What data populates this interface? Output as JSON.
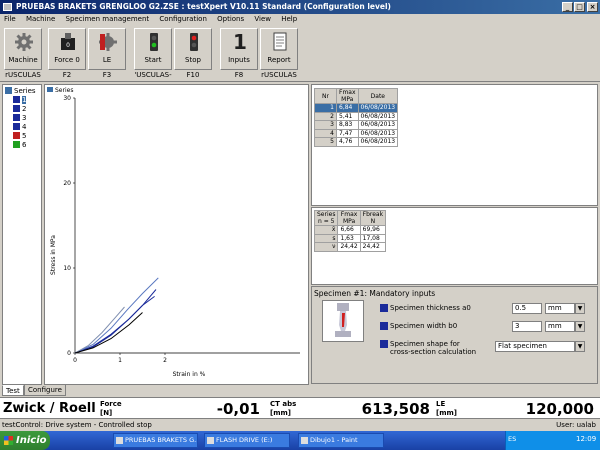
{
  "window": {
    "title": "PRUEBAS BRAKETS GRENGLOO G2.ZSE : testXpert V10.11 Standard (Configuration level)",
    "controls": [
      "_",
      "□",
      "×"
    ]
  },
  "menu": [
    "File",
    "Machine",
    "Specimen management",
    "Configuration",
    "Options",
    "View",
    "Help"
  ],
  "toolbar": [
    {
      "label": "Machine",
      "key": "rUSCULAS",
      "icon": "gear-icon"
    },
    {
      "label": "Force 0",
      "key": "F2",
      "icon": "force-zero-icon"
    },
    {
      "label": "LE",
      "key": "F3",
      "icon": "le-gear-icon"
    },
    {
      "label": "Start",
      "key": "'USCULAS-",
      "icon": "traffic-light-green-icon"
    },
    {
      "label": "Stop",
      "key": "F10",
      "icon": "traffic-light-red-icon"
    },
    {
      "label": "Inputs",
      "key": "F8",
      "icon": "inputs-number-icon",
      "glyph": "1"
    },
    {
      "label": "Report",
      "key": "rUSCULAS",
      "icon": "report-icon"
    }
  ],
  "tree": {
    "root": "Series",
    "items": [
      "1",
      "2",
      "3",
      "4",
      "5",
      "6"
    ]
  },
  "chart_data": {
    "type": "line",
    "legend": "Series",
    "xlabel": "Strain in %",
    "ylabel": "Stress in MPa",
    "xlim": [
      0,
      5
    ],
    "ylim": [
      0,
      30
    ],
    "xticks": [
      "0",
      "1",
      "2"
    ],
    "yticks": [
      "0",
      "10",
      "20",
      "30"
    ],
    "series": [
      {
        "color": "#1a2a9a",
        "x": [
          0,
          0.4,
          0.8,
          1.2,
          1.5,
          1.77
        ],
        "y": [
          0,
          0.8,
          2.2,
          4.0,
          5.6,
          6.66
        ]
      },
      {
        "color": "#5a78c0",
        "x": [
          0,
          0.4,
          0.8,
          1.2,
          1.5,
          1.85
        ],
        "y": [
          0,
          1.0,
          2.9,
          5.3,
          7.0,
          8.83
        ]
      },
      {
        "color": "#1a2a9a",
        "x": [
          0,
          0.4,
          0.8,
          1.2,
          1.5,
          1.8
        ],
        "y": [
          0,
          0.7,
          2.1,
          4.0,
          5.6,
          7.47
        ]
      },
      {
        "color": "#7f8fb0",
        "x": [
          0,
          0.3,
          0.6,
          0.9,
          1.1
        ],
        "y": [
          0,
          0.9,
          2.4,
          4.2,
          5.41
        ]
      },
      {
        "color": "#000000",
        "x": [
          0,
          0.4,
          0.8,
          1.2,
          1.5
        ],
        "y": [
          0,
          0.6,
          1.7,
          3.3,
          4.76
        ]
      }
    ]
  },
  "results": {
    "headers": [
      [
        "Nr",
        ""
      ],
      [
        "Fmax",
        "MPa"
      ],
      [
        "Date",
        ""
      ]
    ],
    "rows": [
      [
        "1",
        "6,84",
        "06/08/2013"
      ],
      [
        "2",
        "5,41",
        "06/08/2013"
      ],
      [
        "3",
        "8,83",
        "06/08/2013"
      ],
      [
        "4",
        "7,47",
        "06/08/2013"
      ],
      [
        "5",
        "4,76",
        "06/08/2013"
      ]
    ],
    "selected_row": 0
  },
  "stats": {
    "headers": [
      [
        "Series",
        "n = 5"
      ],
      [
        "Fmax",
        "MPa"
      ],
      [
        "Fbreak",
        "N"
      ]
    ],
    "rows": [
      [
        "x̄",
        "6,66",
        "69,96"
      ],
      [
        "s",
        "1,63",
        "17,08"
      ],
      [
        "ν",
        "24,42",
        "24,42"
      ]
    ]
  },
  "specimen": {
    "title": "Specimen #1: Mandatory inputs",
    "thickness_label": "Specimen thickness a0",
    "thickness_value": "0.5",
    "thickness_unit": "mm",
    "width_label": "Specimen width b0",
    "width_value": "3",
    "width_unit": "mm",
    "shape_label_1": "Specimen shape for",
    "shape_label_2": "cross-section calculation",
    "shape_value": "Flat specimen"
  },
  "tabs": [
    "Test",
    "Configure"
  ],
  "readouts": {
    "brand": "Zwick / Roell",
    "force_label": "Force",
    "force_unit": "[N]",
    "force_value": "-0,01",
    "ct_label": "CT abs",
    "ct_unit": "[mm]",
    "ct_value": "613,508",
    "le_label": "LE",
    "le_unit": "[mm]",
    "le_value": "120,000"
  },
  "status": {
    "left": "testControl: Drive system - Controlled stop",
    "right": "User: ualab"
  },
  "taskbar": {
    "start": "Inicio",
    "tasks": [
      "PRUEBAS BRAKETS G...",
      "FLASH DRIVE (E:)",
      "Dibujo1 - Paint"
    ],
    "clock": "12:09",
    "lang": "ES"
  }
}
